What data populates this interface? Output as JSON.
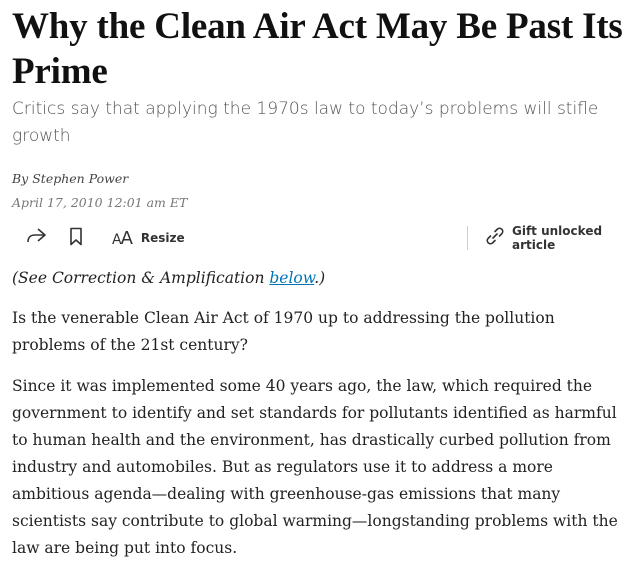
{
  "article": {
    "headline": "Why the Clean Air Act May Be Past Its Prime",
    "dek": "Critics say that applying the 1970s law to today’s problems will stifle growth",
    "byline_prefix": "By",
    "author": "Stephen Power",
    "date": "April 17, 2010 12:01 am ET"
  },
  "toolbar": {
    "share_icon": "share-arrow-icon",
    "bookmark_icon": "bookmark-icon",
    "resize_icon": "text-resize-icon",
    "resize_label": "Resize",
    "gift_icon": "link-icon",
    "gift_label": "Gift unlocked article"
  },
  "correction": {
    "prefix": "(See Correction & Amplification ",
    "link_text": "below",
    "suffix": ".)"
  },
  "paragraphs": [
    "Is the venerable Clean Air Act of 1970 up to addressing the pollution problems of the 21st century?",
    "Since it was implemented some 40 years ago, the law, which required the government to identify and set standards for pollutants identified as harmful to human health and the environment, has drastically curbed pollution from industry and automobiles. But as regulators use it to address a more ambitious agenda—dealing with greenhouse-gas emissions that many scientists say contribute to global warming—longstanding problems with the law are being put into focus."
  ],
  "colors": {
    "link": "#0274b6",
    "text": "#222222",
    "dek": "#555555"
  }
}
